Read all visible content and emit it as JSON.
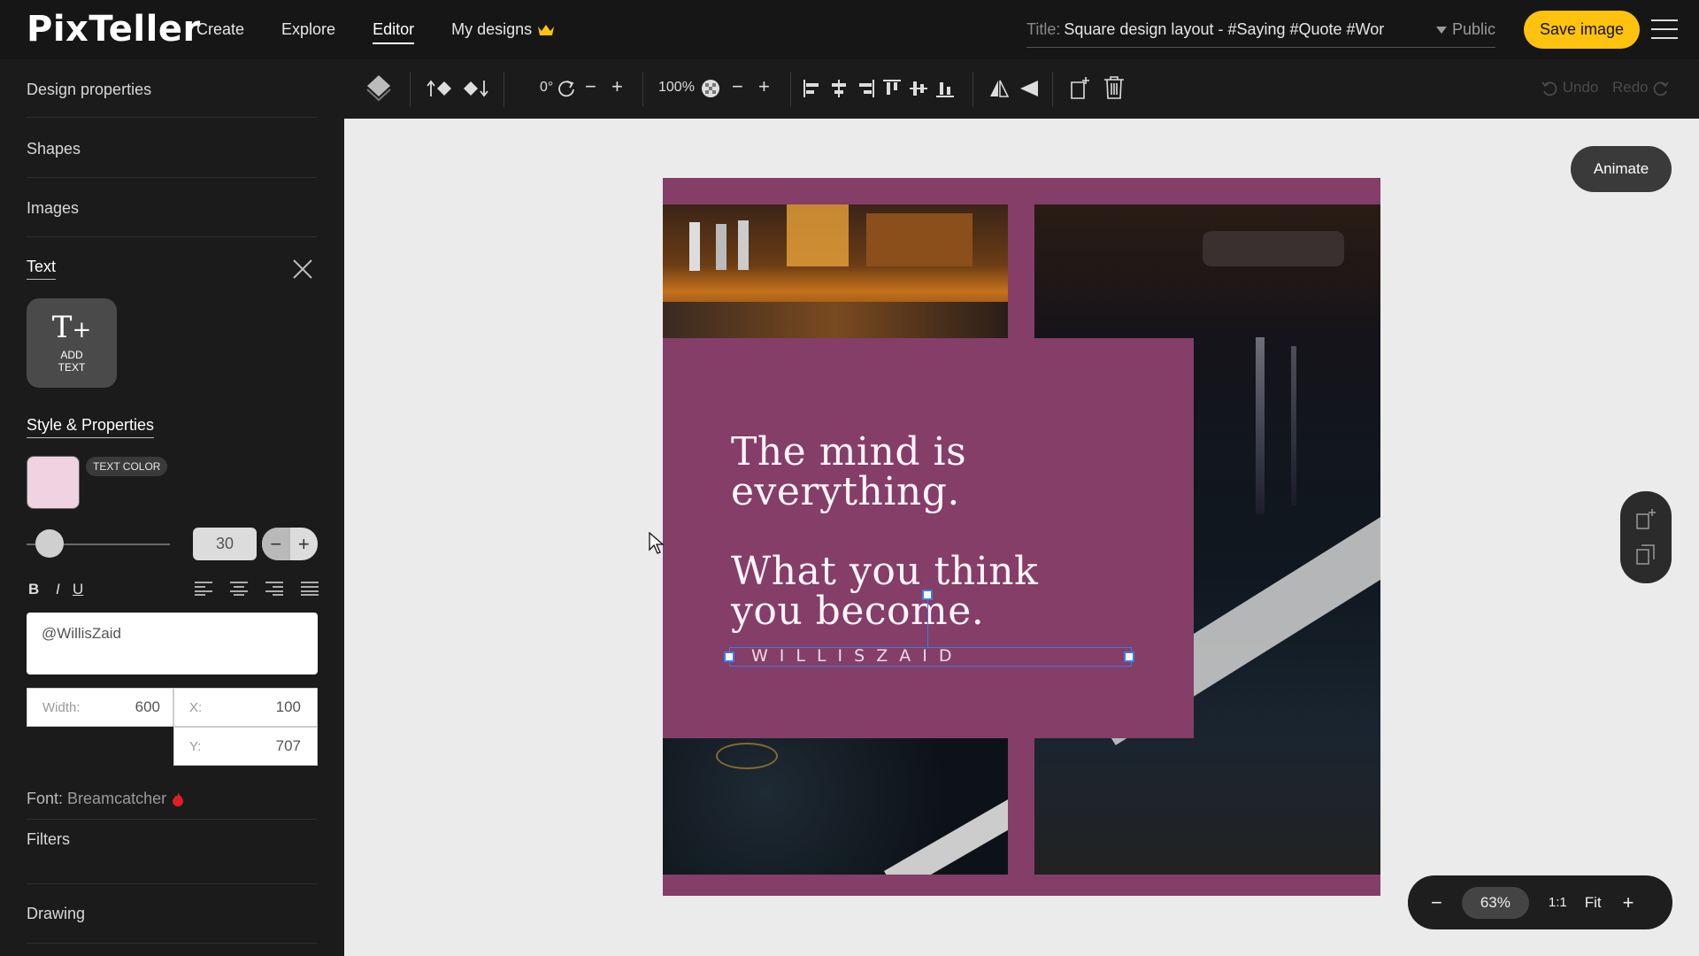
{
  "app": {
    "logo": "PixTeller",
    "nav": [
      "Create",
      "Explore",
      "Editor",
      "My designs"
    ],
    "active_nav": "Editor",
    "title_label": "Title:",
    "title_value": "Square design layout - #Saying #Quote #Wor",
    "visibility": "Public",
    "save_label": "Save image"
  },
  "sidebar": {
    "sections": [
      "Design properties",
      "Shapes",
      "Images"
    ],
    "text_heading": "Text",
    "add_text_label": "ADD TEXT",
    "style_heading": "Style & Properties",
    "text_color_label": "TEXT COLOR",
    "text_color": "#efd3e0",
    "font_size": "30",
    "bold": "B",
    "italic": "I",
    "underline": "U",
    "text_value": "@WillisZaid",
    "width_label": "Width:",
    "width_value": "600",
    "x_label": "X:",
    "x_value": "100",
    "y_label": "Y:",
    "y_value": "707",
    "font_label": "Font:",
    "font_name": "Breamcatcher",
    "filters": "Filters",
    "drawing": "Drawing"
  },
  "toolbar": {
    "rotation": "0°",
    "zoom": "100%",
    "undo": "Undo",
    "redo": "Redo"
  },
  "canvas": {
    "design_bg": "#843e68",
    "quote_line1": "The mind is\neverything.",
    "quote_line2": "What you think\nyou become.",
    "handle": "WILLISZAID",
    "animate_label": "Animate",
    "zoom_level": "63%",
    "ratio_label": "1:1",
    "fit_label": "Fit"
  }
}
